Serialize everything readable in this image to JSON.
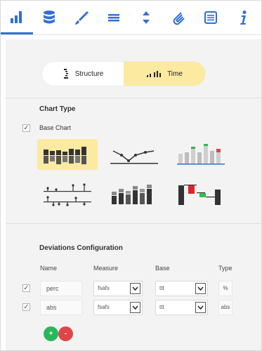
{
  "toolbar": {
    "tabs": [
      {
        "icon": "bar-chart-icon"
      },
      {
        "icon": "database-icon"
      },
      {
        "icon": "brush-icon"
      },
      {
        "icon": "lines-icon"
      },
      {
        "icon": "sort-icon"
      },
      {
        "icon": "paperclip-icon"
      },
      {
        "icon": "list-icon"
      },
      {
        "icon": "info-icon"
      }
    ],
    "active": "bar-chart-icon",
    "accent": "#2f6fd6"
  },
  "mode_toggle": {
    "structure_label": "Structure",
    "time_label": "Time",
    "selected": "Time",
    "selected_color": "#fbeaa0"
  },
  "chart_type": {
    "heading": "Chart Type",
    "base_chart_label": "Base Chart",
    "base_chart_checked": true,
    "options": [
      {
        "icon": "bar-deviation-chart-icon",
        "selected": true
      },
      {
        "icon": "line-chart-icon",
        "selected": false
      },
      {
        "icon": "variance-bars-icon",
        "selected": false
      },
      {
        "icon": "pin-chart-icon",
        "selected": false
      },
      {
        "icon": "stacked-bars-icon",
        "selected": false
      },
      {
        "icon": "waterfall-chart-icon",
        "selected": false
      }
    ]
  },
  "deviations": {
    "heading": "Deviations Configuration",
    "columns": [
      "Name",
      "Measure",
      "Base",
      "Type"
    ],
    "rows": [
      {
        "checked": true,
        "name": "perc",
        "measure": "fsafs",
        "base": "ttt",
        "type": "%"
      },
      {
        "checked": true,
        "name": "abs",
        "measure": "fsafs",
        "base": "ttt",
        "type": "abs"
      }
    ],
    "add_label": "+",
    "remove_label": "-",
    "add_color": "#27b85a",
    "remove_color": "#e0454a"
  }
}
